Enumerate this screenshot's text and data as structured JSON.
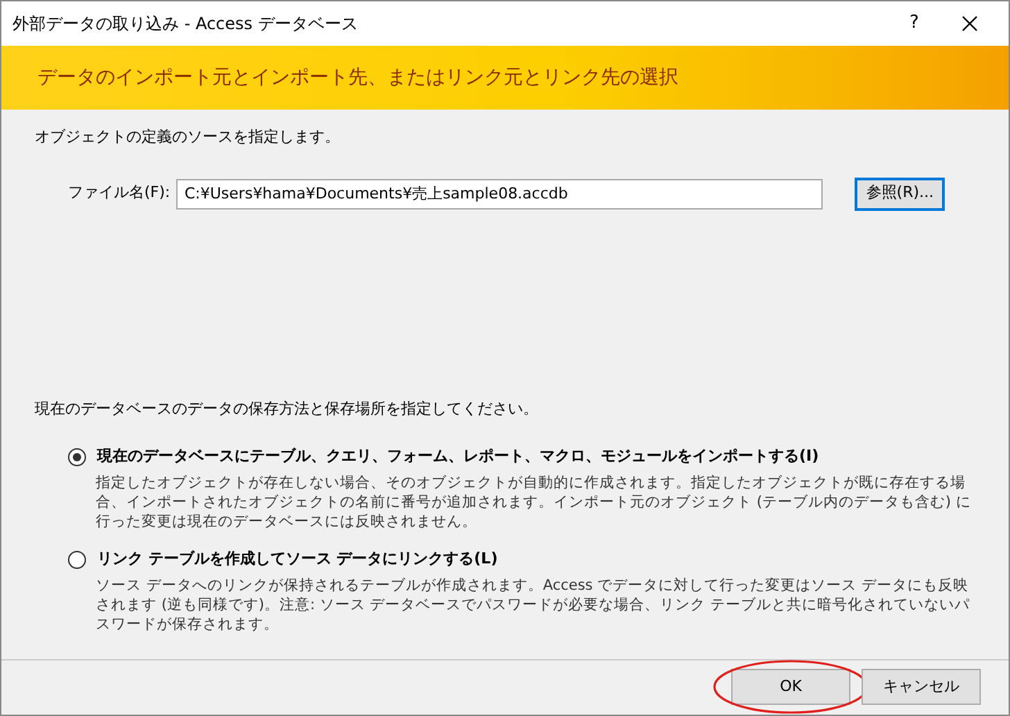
{
  "window": {
    "title": "外部データの取り込み - Access データベース",
    "help": "?"
  },
  "banner": {
    "title": "データのインポート元とインポート先、またはリンク元とリンク先の選択"
  },
  "source": {
    "instruction": "オブジェクトの定義のソースを指定します。",
    "file_label": "ファイル名(F):",
    "file_value": "C:¥Users¥hama¥Documents¥売上sample08.accdb",
    "browse_button": "参照(R)..."
  },
  "storage": {
    "instruction": "現在のデータベースのデータの保存方法と保存場所を指定してください。",
    "options": [
      {
        "label": "現在のデータベースにテーブル、クエリ、フォーム、レポート、マクロ、モジュールをインポートする(I)",
        "selected": true,
        "description": "指定したオブジェクトが存在しない場合、そのオブジェクトが自動的に作成されます。指定したオブジェクトが既に存在する場合、インポートされたオブジェクトの名前に番号が追加されます。インポート元のオブジェクト (テーブル内のデータも含む) に行った変更は現在のデータベースには反映されません。"
      },
      {
        "label": "リンク テーブルを作成してソース データにリンクする(L)",
        "selected": false,
        "description": "ソース データへのリンクが保持されるテーブルが作成されます。Access でデータに対して行った変更はソース データにも反映されます (逆も同様です)。注意: ソース データベースでパスワードが必要な場合、リンク テーブルと共に暗号化されていないパスワードが保存されます。"
      }
    ]
  },
  "buttons": [
    {
      "label": "OK",
      "highlighted": true
    },
    {
      "label": "キャンセル",
      "highlighted": false
    }
  ]
}
